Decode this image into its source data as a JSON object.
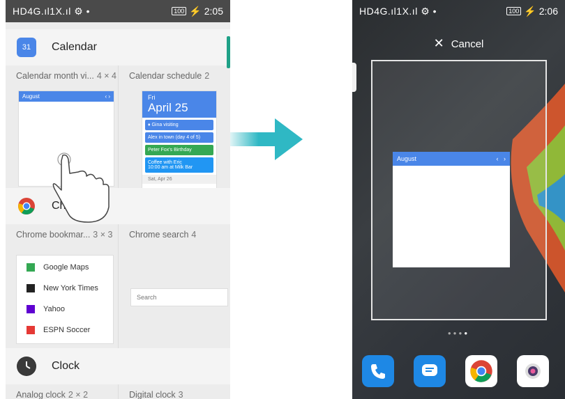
{
  "left": {
    "status": {
      "signal": "HD4G.ıl1X.ıl ⚙ •",
      "battery": "100",
      "time": "2:05"
    },
    "calendar_app": {
      "name": "Calendar",
      "icon_text": "31"
    },
    "calendar_widgets": [
      {
        "label": "Calendar month vi...",
        "size": "4 × 4"
      },
      {
        "label": "Calendar schedule",
        "size": "2"
      }
    ],
    "mini_calendar": {
      "month": "August"
    },
    "schedule": {
      "day": "Fri",
      "date": "April 25",
      "items": [
        {
          "text": "♦ Gina visiting",
          "color": "#4a86e8"
        },
        {
          "text": "Alex in town (day 4 of 5)",
          "color": "#4a86e8"
        },
        {
          "text": "Peter Fox's Birthday",
          "color": "#35a853"
        },
        {
          "text": "Coffee with Eric\n10:00 am at Milk Bar",
          "color": "#2196f3"
        }
      ],
      "footer": "Sat, Apr 26"
    },
    "chrome_app": {
      "name": "Ch"
    },
    "chrome_widgets": [
      {
        "label": "Chrome bookmar...",
        "size": "3 × 3"
      },
      {
        "label": "Chrome search",
        "size": "4"
      }
    ],
    "bookmarks": [
      {
        "label": "Google Maps",
        "icon": "maps-icon",
        "color": "#34a853"
      },
      {
        "label": "New York Times",
        "icon": "nyt-icon",
        "color": "#222222"
      },
      {
        "label": "Yahoo",
        "icon": "yahoo-icon",
        "color": "#5f01d1"
      },
      {
        "label": "ESPN Soccer",
        "icon": "espn-icon",
        "color": "#e53935"
      }
    ],
    "search_placeholder": "Search",
    "clock_app": {
      "name": "Clock"
    },
    "clock_widgets": [
      {
        "label": "Analog clock",
        "size": "2 × 2"
      },
      {
        "label": "Digital clock",
        "size": "3"
      }
    ]
  },
  "right": {
    "status": {
      "signal": "HD4G.ıl1X.ıl ⚙ •",
      "battery": "100",
      "time": "2:06"
    },
    "cancel_label": "Cancel",
    "calendar": {
      "month": "August"
    },
    "dock": [
      "phone-icon",
      "messages-icon",
      "chrome-icon",
      "camera-icon"
    ]
  },
  "colors": {
    "accent_blue": "#4a86e8",
    "arrow": "#2fb8c4",
    "scroll": "#1fa187"
  }
}
